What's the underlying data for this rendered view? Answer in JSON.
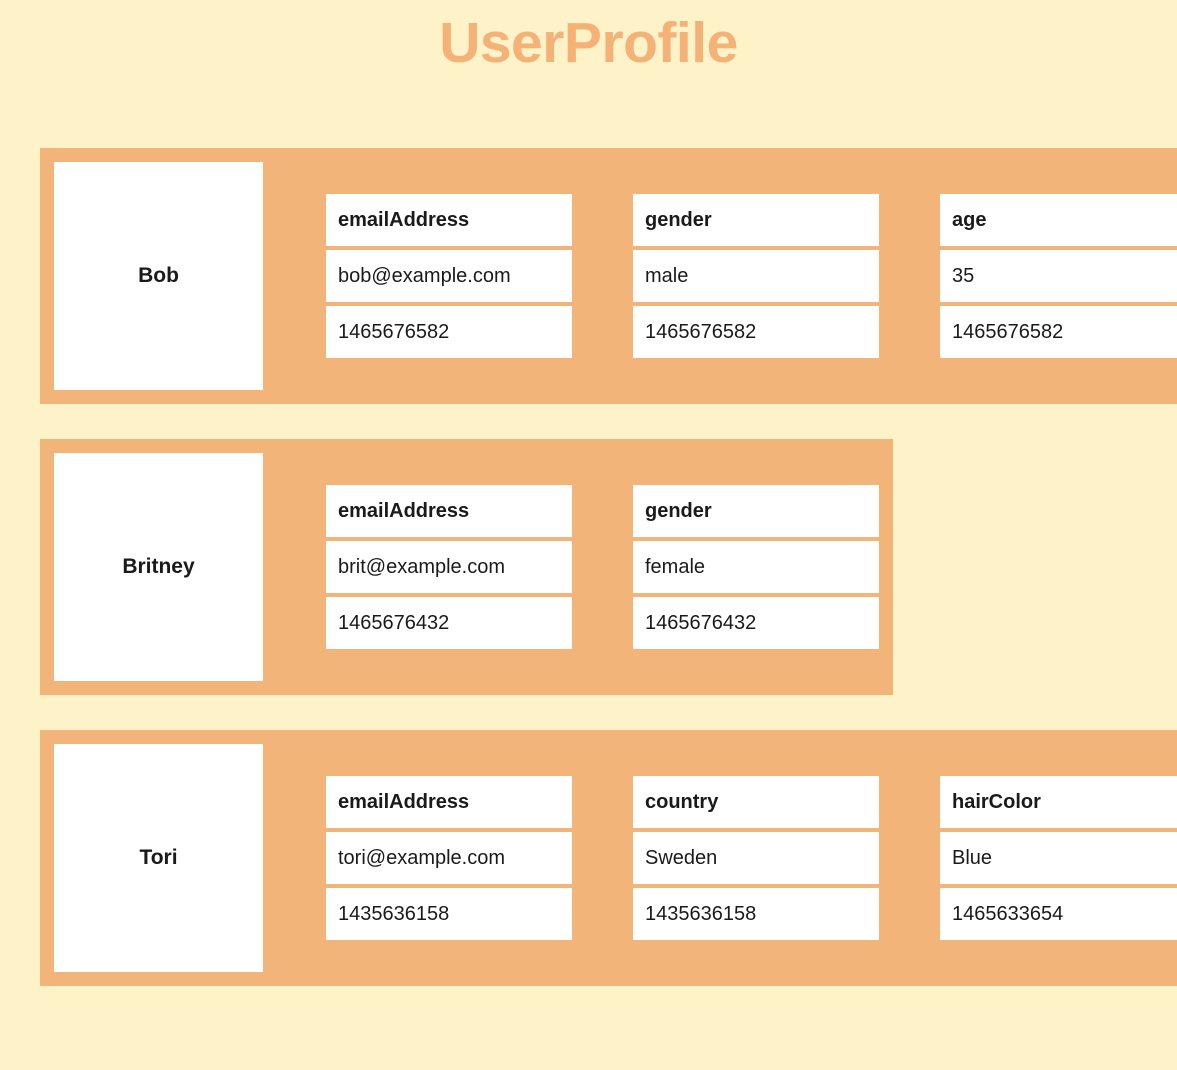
{
  "title": "UserProfile",
  "colors": {
    "background": "#FDF2C8",
    "card": "#F2B479",
    "title": "#F5B277",
    "cell_background": "#FFFFFF",
    "text": "#1A1A1A"
  },
  "profiles": [
    {
      "name": "Bob",
      "fields": [
        {
          "key": "emailAddress",
          "value": "bob@example.com",
          "timestamp": "1465676582"
        },
        {
          "key": "gender",
          "value": "male",
          "timestamp": "1465676582"
        },
        {
          "key": "age",
          "value": "35",
          "timestamp": "1465676582"
        }
      ]
    },
    {
      "name": "Britney",
      "fields": [
        {
          "key": "emailAddress",
          "value": "brit@example.com",
          "timestamp": "1465676432"
        },
        {
          "key": "gender",
          "value": "female",
          "timestamp": "1465676432"
        }
      ]
    },
    {
      "name": "Tori",
      "fields": [
        {
          "key": "emailAddress",
          "value": "tori@example.com",
          "timestamp": "1435636158"
        },
        {
          "key": "country",
          "value": "Sweden",
          "timestamp": "1435636158"
        },
        {
          "key": "hairColor",
          "value": "Blue",
          "timestamp": "1465633654"
        }
      ]
    }
  ]
}
